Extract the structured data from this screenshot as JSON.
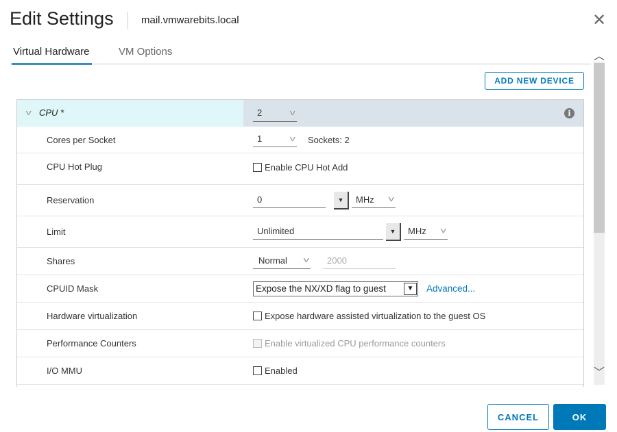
{
  "header": {
    "title": "Edit Settings",
    "vm_name": "mail.vmwarebits.local",
    "close_icon": "close-icon"
  },
  "tabs": [
    {
      "label": "Virtual Hardware",
      "active": true
    },
    {
      "label": "VM Options",
      "active": false
    }
  ],
  "add_device_label": "ADD NEW DEVICE",
  "cpu": {
    "label": "CPU *",
    "value": "2",
    "cores_per_socket": {
      "label": "Cores per Socket",
      "value": "1",
      "sockets_text": "Sockets: 2"
    },
    "hot_plug": {
      "label": "CPU Hot Plug",
      "checkbox": "Enable CPU Hot Add",
      "checked": false
    },
    "reservation": {
      "label": "Reservation",
      "value": "0",
      "unit": "MHz"
    },
    "limit": {
      "label": "Limit",
      "value": "Unlimited",
      "unit": "MHz"
    },
    "shares": {
      "label": "Shares",
      "level": "Normal",
      "value": "2000"
    },
    "cpuid": {
      "label": "CPUID Mask",
      "value": "Expose the NX/XD flag to guest",
      "advanced": "Advanced..."
    },
    "hw_virt": {
      "label": "Hardware virtualization",
      "checkbox": "Expose hardware assisted virtualization to the guest OS",
      "checked": false
    },
    "perf": {
      "label": "Performance Counters",
      "checkbox": "Enable virtualized CPU performance counters",
      "checked": false
    },
    "iommu": {
      "label": "I/O MMU",
      "checkbox": "Enabled",
      "checked": false
    }
  },
  "footer": {
    "cancel": "CANCEL",
    "ok": "OK"
  }
}
